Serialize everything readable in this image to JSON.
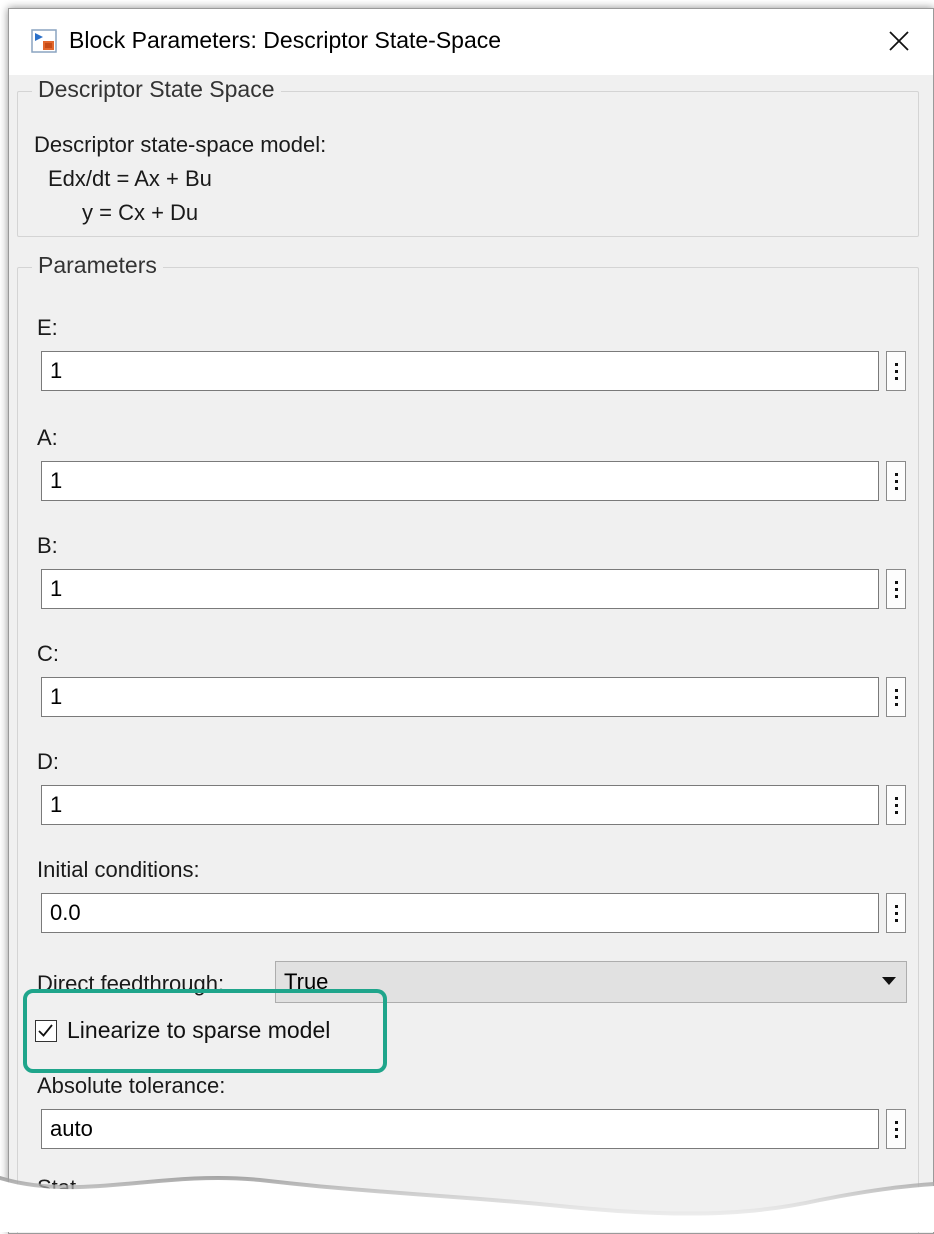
{
  "window": {
    "title": "Block Parameters: Descriptor State-Space"
  },
  "description": {
    "group_label": "Descriptor State Space",
    "lines": [
      "Descriptor state-space model:",
      "Edx/dt = Ax + Bu",
      "y = Cx + Du"
    ]
  },
  "parameters": {
    "group_label": "Parameters",
    "fields": [
      {
        "label": "E:",
        "value": "1"
      },
      {
        "label": "A:",
        "value": "1"
      },
      {
        "label": "B:",
        "value": "1"
      },
      {
        "label": "C:",
        "value": "1"
      },
      {
        "label": "D:",
        "value": "1"
      },
      {
        "label": "Initial conditions:",
        "value": "0.0"
      }
    ],
    "direct_feedthrough": {
      "label": "Direct feedthrough:",
      "value": "True"
    },
    "linearize_checkbox": {
      "label": "Linearize to sparse model",
      "checked": true
    },
    "absolute_tolerance": {
      "label": "Absolute tolerance:",
      "value": "auto"
    },
    "cut_off_label": "Stat"
  },
  "colors": {
    "highlight": "#1fa58b",
    "window_bg": "#f0f0f0"
  },
  "icons": [
    "simulink-block-icon",
    "close-icon",
    "more-options-icon",
    "dropdown-arrow-icon",
    "checkmark-icon"
  ]
}
